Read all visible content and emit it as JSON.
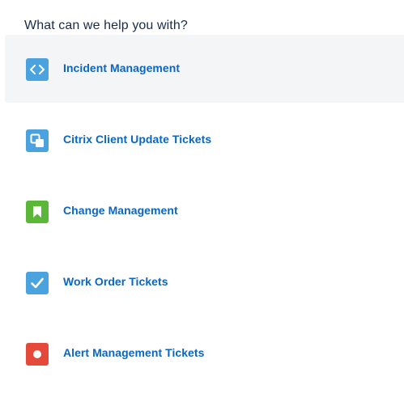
{
  "heading": "What can we help you with?",
  "items": [
    {
      "label": "Incident Management",
      "icon": "code-brackets-icon",
      "color": "#4aa3df",
      "selected": true
    },
    {
      "label": "Citrix Client Update Tickets",
      "icon": "copy-squares-icon",
      "color": "#4aa3df",
      "selected": false
    },
    {
      "label": "Change Management",
      "icon": "bookmark-icon",
      "color": "#5ab738",
      "selected": false
    },
    {
      "label": "Work Order Tickets",
      "icon": "checkmark-icon",
      "color": "#4aa3df",
      "selected": false
    },
    {
      "label": "Alert Management Tickets",
      "icon": "record-dot-icon",
      "color": "#e5493a",
      "selected": false
    }
  ],
  "colors": {
    "heading_text": "#172b4d",
    "link_text": "#0b66c3",
    "selected_bg": "#f4f5f7"
  }
}
